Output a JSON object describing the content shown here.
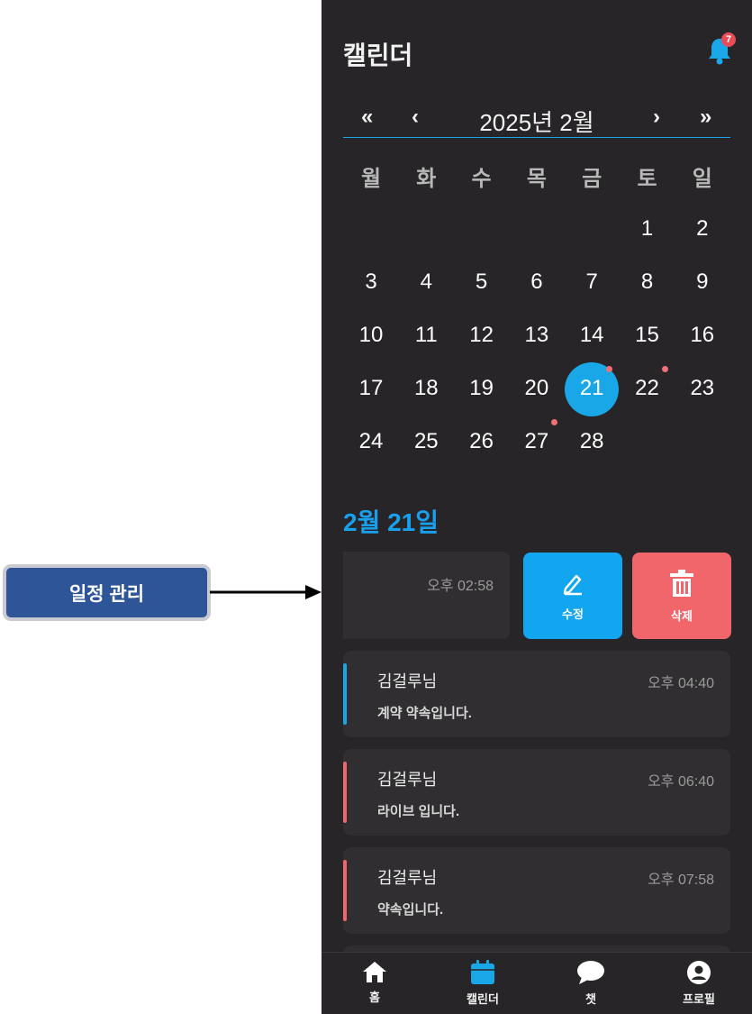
{
  "annotation": {
    "label": "일정 관리"
  },
  "header": {
    "title": "캘린더",
    "notification_count": "7"
  },
  "calendar": {
    "nav": {
      "prev_year": "«",
      "prev_month": "‹",
      "next_month": "›",
      "next_year": "»"
    },
    "month_label": "2025년 2월",
    "weekdays": [
      "월",
      "화",
      "수",
      "목",
      "금",
      "토",
      "일"
    ],
    "days": [
      "1",
      "2",
      "3",
      "4",
      "5",
      "6",
      "7",
      "8",
      "9",
      "10",
      "11",
      "12",
      "13",
      "14",
      "15",
      "16",
      "17",
      "18",
      "19",
      "20",
      "21",
      "22",
      "23",
      "24",
      "25",
      "26",
      "27",
      "28"
    ],
    "first_weekday_index": 5,
    "selected_day": "21",
    "days_with_events": [
      "21",
      "22",
      "27"
    ],
    "accent_color": "#1aa7e8",
    "event_dot_color": "#f07078"
  },
  "schedule": {
    "date_heading": "2월 21일",
    "swiped_item": {
      "time": "오후 02:58"
    },
    "actions": {
      "edit_label": "수정",
      "delete_label": "삭제",
      "edit_color": "#11a6ef",
      "delete_color": "#f0666b"
    },
    "events": [
      {
        "name": "김걸루님",
        "time": "오후 04:40",
        "desc": "계약 약속입니다.",
        "color": "#1aa7e8"
      },
      {
        "name": "김걸루님",
        "time": "오후 06:40",
        "desc": "라이브 입니다.",
        "color": "#f0666b"
      },
      {
        "name": "김걸루님",
        "time": "오후 07:58",
        "desc": "약속입니다.",
        "color": "#f0666b"
      }
    ]
  },
  "tabbar": {
    "items": [
      {
        "label": "홈",
        "icon": "home-icon"
      },
      {
        "label": "캘린더",
        "icon": "calendar-icon",
        "active": true
      },
      {
        "label": "챗",
        "icon": "chat-icon"
      },
      {
        "label": "프로필",
        "icon": "profile-icon"
      }
    ],
    "active_color": "#1aa7e8"
  }
}
